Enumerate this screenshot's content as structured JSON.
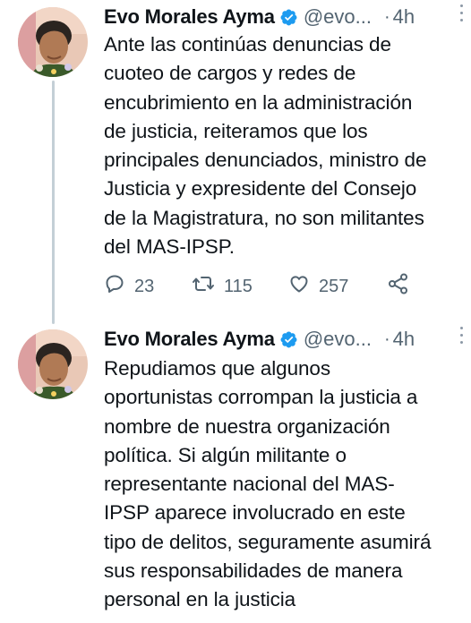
{
  "thread": [
    {
      "author": {
        "name": "Evo Morales Ayma",
        "handle": "@evo...",
        "verified": true,
        "avatar_icon": "profile-photo"
      },
      "separator": "·",
      "time": "4h",
      "text": "Ante las continúas denuncias de\ncuoteo de cargos y redes de\nencubrimiento en la administración\nde justicia, reiteramos que los\nprincipales denunciados, ministro de\nJusticia y expresidente del Consejo\nde la Magistratura, no son militantes\ndel MAS-IPSP.",
      "actions": {
        "replies": "23",
        "retweets": "115",
        "likes": "257"
      }
    },
    {
      "author": {
        "name": "Evo Morales Ayma",
        "handle": "@evo...",
        "verified": true,
        "avatar_icon": "profile-photo"
      },
      "separator": "·",
      "time": "4h",
      "text": "Repudiamos que algunos\noportunistas corrompan la justicia a\nnombre de nuestra organización\npolítica. Si algún militante o\nrepresentante nacional del MAS-\nIPSP aparece involucrado en este\ntipo de delitos, seguramente asumirá\nsus responsabilidades de manera\npersonal en la justicia"
    }
  ],
  "colors": {
    "text": "#0f1419",
    "secondary": "#536471",
    "verified": "#1d9bf0",
    "thread_line": "#c4cfd6"
  },
  "icons": [
    "verified-badge-icon",
    "more-options-icon",
    "reply-icon",
    "retweet-icon",
    "like-icon",
    "share-icon"
  ]
}
